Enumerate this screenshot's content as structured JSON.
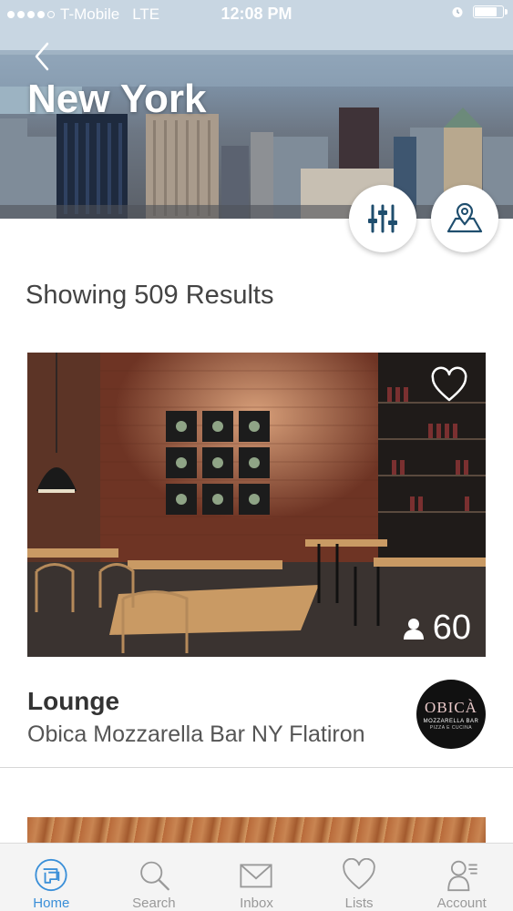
{
  "status_bar": {
    "carrier": "T-Mobile",
    "network": "LTE",
    "time": "12:08 PM",
    "signal_bars": 4,
    "battery_level": 0.8
  },
  "header": {
    "city": "New York",
    "back_icon": "chevron-left-icon"
  },
  "actions": {
    "filter_icon": "sliders-icon",
    "map_icon": "map-pin-icon"
  },
  "results": {
    "label": "Showing 509 Results"
  },
  "listing": {
    "type": "Lounge",
    "name": "Obica Mozzarella Bar NY Flatiron",
    "capacity": "60",
    "favorite_icon": "heart-icon",
    "capacity_icon": "person-icon",
    "logo": {
      "brand": "OBICÀ",
      "line1": "MOZZARELLA BAR",
      "line2": "PIZZA E CUCINA"
    }
  },
  "tabs": [
    {
      "label": "Home",
      "icon": "home-icon",
      "active": true
    },
    {
      "label": "Search",
      "icon": "search-icon",
      "active": false
    },
    {
      "label": "Inbox",
      "icon": "envelope-icon",
      "active": false
    },
    {
      "label": "Lists",
      "icon": "heart-icon",
      "active": false
    },
    {
      "label": "Account",
      "icon": "account-icon",
      "active": false
    }
  ],
  "colors": {
    "accent": "#3a8fd8",
    "icon_dark": "#1f4e6e",
    "tab_inactive": "#999999"
  }
}
